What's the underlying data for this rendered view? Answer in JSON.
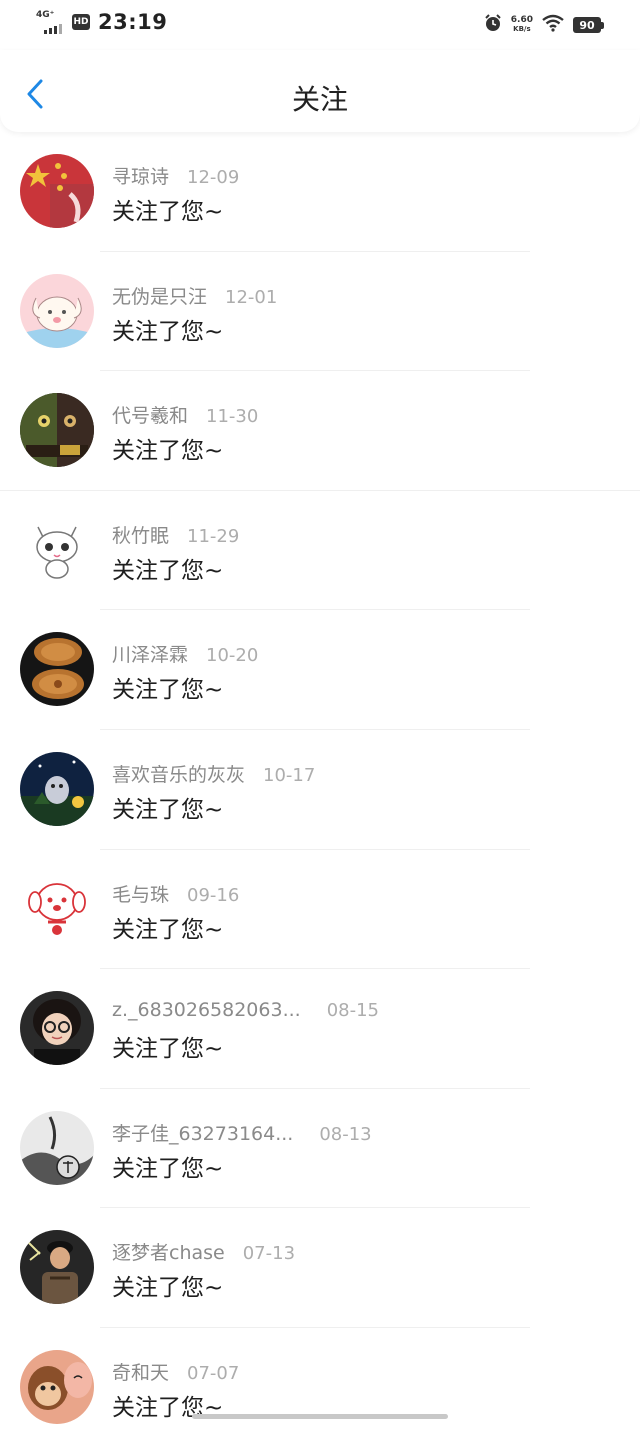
{
  "status_bar": {
    "network": "4G⁺",
    "hd": "HD",
    "time": "23:19",
    "speed_value": "6.60",
    "speed_unit": "KB/s",
    "battery": "90"
  },
  "header": {
    "title": "关注",
    "accent_color": "#1e88e5"
  },
  "notifications": [
    {
      "name": "寻琼诗",
      "date": "12-09",
      "action": "关注了您~",
      "avatar_icon": "flag-avatar"
    },
    {
      "name": "无伪是只汪",
      "date": "12-01",
      "action": "关注了您~",
      "avatar_icon": "puppy-avatar"
    },
    {
      "name": "代号羲和",
      "date": "11-30",
      "action": "关注了您~",
      "avatar_icon": "cartoon-avatar"
    },
    {
      "name": "秋竹眠",
      "date": "11-29",
      "action": "关注了您~",
      "avatar_icon": "cat-avatar"
    },
    {
      "name": "川泽泽霖",
      "date": "10-20",
      "action": "关注了您~",
      "avatar_icon": "mooncake-avatar"
    },
    {
      "name": "喜欢音乐的灰灰",
      "date": "10-17",
      "action": "关注了您~",
      "avatar_icon": "night-avatar"
    },
    {
      "name": "毛与珠",
      "date": "09-16",
      "action": "关注了您~",
      "avatar_icon": "dog-avatar"
    },
    {
      "name": "z._683026582063...",
      "date": "08-15",
      "action": "关注了您~",
      "avatar_icon": "girl-avatar"
    },
    {
      "name": "李子佳_63273164...",
      "date": "08-13",
      "action": "关注了您~",
      "avatar_icon": "ink-avatar"
    },
    {
      "name": "逐梦者chase",
      "date": "07-13",
      "action": "关注了您~",
      "avatar_icon": "person-avatar"
    },
    {
      "name": "奇和天",
      "date": "07-07",
      "action": "关注了您~",
      "avatar_icon": "monkey-avatar"
    }
  ]
}
